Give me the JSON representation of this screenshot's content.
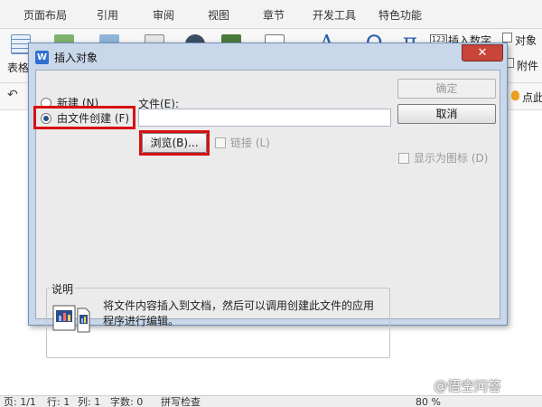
{
  "ribbon": {
    "tabs": [
      "页面布局",
      "引用",
      "审阅",
      "视图",
      "章节",
      "开发工具",
      "特色功能"
    ],
    "tools": {
      "table_label": "表格",
      "insert_number_badge": "123",
      "insert_number_label": "插入数字",
      "object_label": "对象",
      "attachment_label": "附件",
      "a_glyph": "A",
      "omega_glyph": "Ω",
      "pi_glyph": "π"
    },
    "quickbar": {
      "undo_glyph": "↶",
      "right_label": "点此"
    }
  },
  "dialog": {
    "title": "插入对象",
    "app_icon_letter": "W",
    "close_glyph": "✕",
    "options": {
      "new_label": "新建 (N)",
      "from_file_label": "由文件创建 (F)",
      "selected": "from_file"
    },
    "file_label": "文件(E):",
    "file_value": "",
    "browse_label": "浏览(B)...",
    "link_label": "链接 (L)",
    "link_checked": false,
    "ok_label": "确定",
    "cancel_label": "取消",
    "display_as_icon_label": "显示为图标 (D)",
    "display_as_icon_checked": false,
    "description_title": "说明",
    "description_text": "将文件内容插入到文档，然后可以调用创建此文件的应用程序进行编辑。",
    "highlight_color": "#d90f14"
  },
  "statusbar": {
    "page": "页: 1/1",
    "row": "行: 1",
    "col": "列: 1",
    "words": "字数: 0",
    "spellcheck": "拼写检查",
    "zoom": "80 %"
  },
  "watermark": {
    "text": "@悟空问答"
  },
  "colors": {
    "ok_disabled": "#9b9b9b",
    "close_button": "#c8453a",
    "dialog_frame": "#c9d7ea"
  }
}
